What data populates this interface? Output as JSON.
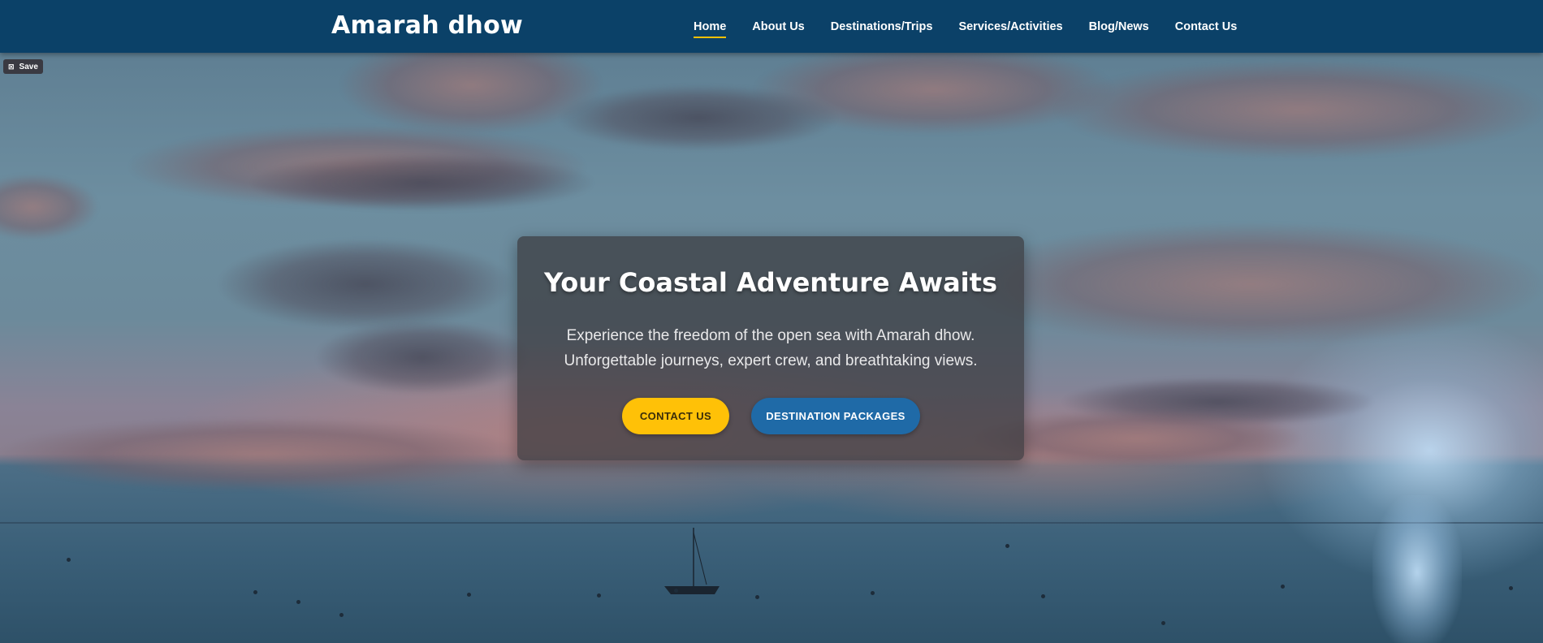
{
  "brand": {
    "name": "Amarah dhow"
  },
  "nav": {
    "items": [
      {
        "label": "Home",
        "active": true
      },
      {
        "label": "About Us"
      },
      {
        "label": "Destinations/Trips"
      },
      {
        "label": "Services/Activities"
      },
      {
        "label": "Blog/News"
      },
      {
        "label": "Contact Us"
      }
    ]
  },
  "overlay": {
    "save_label": "Save",
    "save_icon": "pin-icon"
  },
  "hero": {
    "title": "Your Coastal Adventure Awaits",
    "line1": "Experience the freedom of the open sea with Amarah dhow.",
    "line2": "Unforgettable journeys, expert crew, and breathtaking views.",
    "cta_primary": "CONTACT US",
    "cta_secondary": "DESTINATION PACKAGES"
  },
  "colors": {
    "header": "#0b4168",
    "accent_yellow": "#ffc107",
    "accent_blue": "#1f6aa7"
  }
}
